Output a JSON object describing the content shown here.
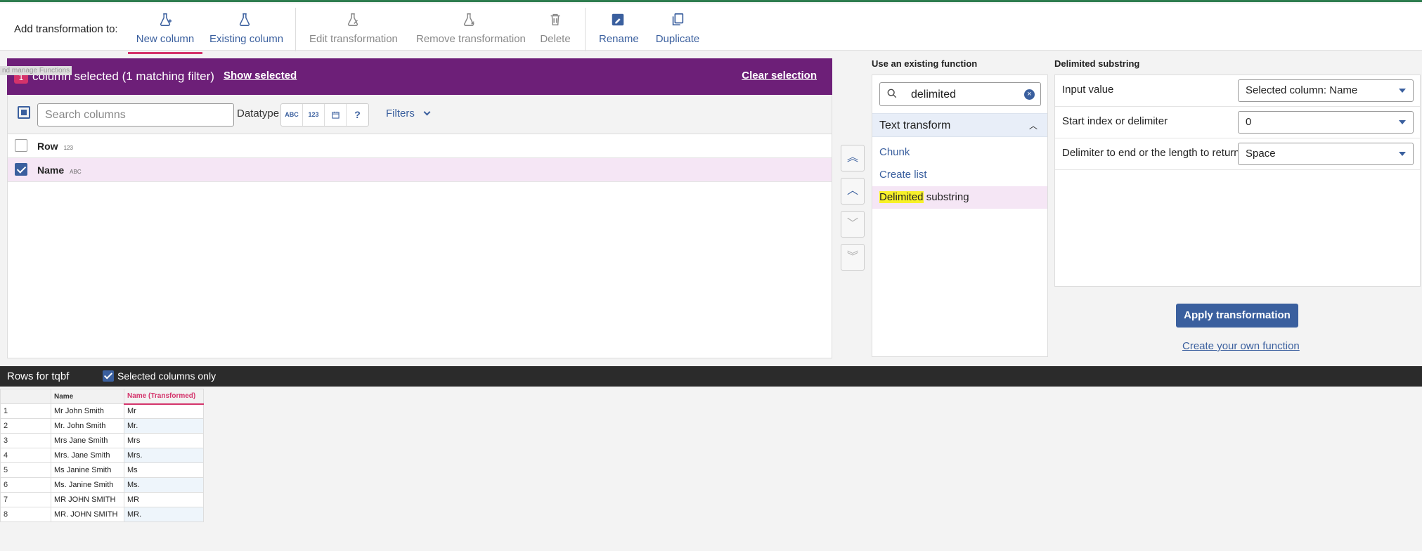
{
  "toolbar": {
    "add_label": "Add transformation to:",
    "buttons": [
      {
        "label": "New column",
        "icon": "flask-plus-icon",
        "active": true,
        "enabled": true
      },
      {
        "label": "Existing column",
        "icon": "flask-icon",
        "enabled": true
      },
      {
        "label": "Edit transformation",
        "icon": "flask-edit-icon",
        "enabled": false
      },
      {
        "label": "Remove transformation",
        "icon": "flask-remove-icon",
        "enabled": false
      },
      {
        "label": "Delete",
        "icon": "trash-icon",
        "enabled": false
      },
      {
        "label": "Rename",
        "icon": "rename-icon",
        "enabled": true
      },
      {
        "label": "Duplicate",
        "icon": "duplicate-icon",
        "enabled": true
      }
    ]
  },
  "ghost_text": "nd manage Functions",
  "selection": {
    "count": "1",
    "text": "column selected (1 matching filter)",
    "show_selected": "Show selected",
    "clear_selection": "Clear selection"
  },
  "filters": {
    "search_placeholder": "Search columns",
    "datatype_label": "Datatype",
    "datatype_options": [
      "ABC",
      "123",
      "date-icon",
      "?"
    ],
    "filters_label": "Filters"
  },
  "columns": [
    {
      "name": "Row",
      "type": "123",
      "checked": false
    },
    {
      "name": "Name",
      "type": "ABC",
      "checked": true
    }
  ],
  "functions": {
    "title": "Use an existing function",
    "search_value": "delimited",
    "group": "Text transform",
    "items": [
      {
        "label": "Chunk"
      },
      {
        "label": "Create list"
      },
      {
        "label_highlight": "Delimited",
        "label_rest": " substring",
        "selected": true
      }
    ]
  },
  "params": {
    "title": "Delimited substring",
    "rows": [
      {
        "label": "Input value",
        "value": "Selected column: Name"
      },
      {
        "label": "Start index or delimiter",
        "value": "0"
      },
      {
        "label": "Delimiter to end or the length to return",
        "value": "Space"
      }
    ],
    "apply": "Apply transformation",
    "create_own": "Create your own function"
  },
  "bottom": {
    "title": "Rows for tqbf",
    "selected_only": "Selected columns only"
  },
  "grid": {
    "headers": [
      "Name",
      "Name (Transformed)"
    ],
    "rows": [
      [
        "1",
        "Mr John Smith",
        "Mr"
      ],
      [
        "2",
        "Mr. John Smith",
        "Mr."
      ],
      [
        "3",
        "Mrs Jane Smith",
        "Mrs"
      ],
      [
        "4",
        "Mrs. Jane Smith",
        "Mrs."
      ],
      [
        "5",
        "Ms Janine Smith",
        "Ms"
      ],
      [
        "6",
        "Ms. Janine Smith",
        "Ms."
      ],
      [
        "7",
        "MR JOHN SMITH",
        "MR"
      ],
      [
        "8",
        "MR. JOHN SMITH",
        "MR."
      ]
    ]
  },
  "colors": {
    "accent": "#3a5f9e",
    "banner": "#6d1f78",
    "pink": "#d4336b"
  }
}
